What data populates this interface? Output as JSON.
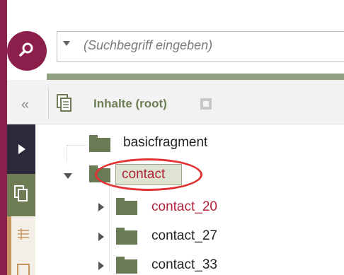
{
  "search": {
    "placeholder": "(Suchbegriff eingeben)"
  },
  "breadcrumb": {
    "collapse_label": "«",
    "root_title": "Inhalte (root)"
  },
  "icons": {
    "search": "search-icon",
    "collapse": "double-chevron-left-icon",
    "documents": "document-stack-icon",
    "lock": "lock-icon",
    "play": "play-icon",
    "pages": "pages-icon",
    "table": "table-icon"
  },
  "tree": {
    "items": [
      {
        "label": "basicfragment",
        "state": "leaf"
      },
      {
        "label": "contact",
        "state": "expanded",
        "selected": true
      },
      {
        "label": "contact_20",
        "state": "collapsed",
        "highlight": true
      },
      {
        "label": "contact_27",
        "state": "collapsed"
      },
      {
        "label": "contact_33",
        "state": "collapsed"
      }
    ]
  },
  "colors": {
    "brand": "#8b1e4a",
    "accent_green": "#6d7c52",
    "annotation_red": "#e23232",
    "highlight_text": "#b0233a"
  }
}
